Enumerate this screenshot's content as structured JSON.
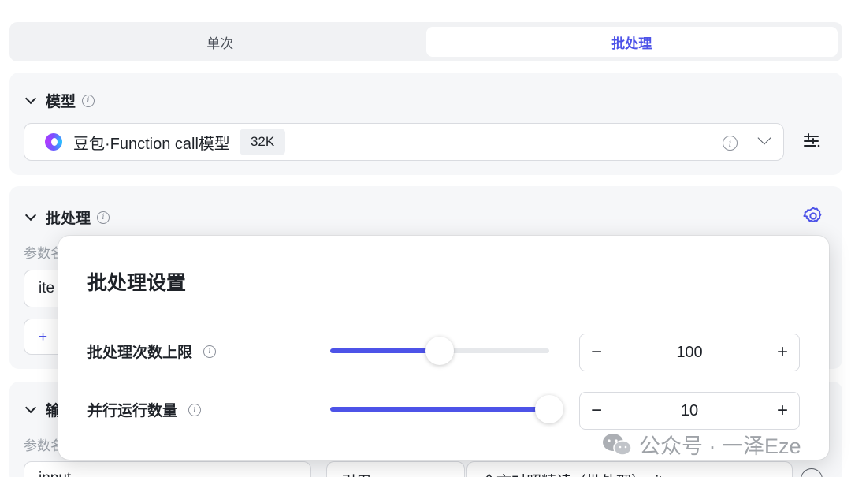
{
  "tabs": [
    {
      "label": "单次",
      "active": false
    },
    {
      "label": "批处理",
      "active": true
    }
  ],
  "model_section": {
    "title": "模型",
    "model_name": "豆包·Function call模型",
    "context_badge": "32K"
  },
  "batch_section": {
    "title": "批处理",
    "param_label_partial": "参数名",
    "field_partial": "ite",
    "add_partial": "+"
  },
  "output_section": {
    "title_partial": "输",
    "param_label_partial": "参数名",
    "field_partial": "input",
    "ref_partial": "引用",
    "source_partial": "全文对照精读（批处理）- it"
  },
  "popup": {
    "title": "批处理设置",
    "rows": [
      {
        "label": "批处理次数上限",
        "value": "100",
        "slider_fraction": 0.5
      },
      {
        "label": "并行运行数量",
        "value": "10",
        "slider_fraction": 1.0
      }
    ],
    "minus": "−",
    "plus": "+"
  },
  "watermark": {
    "text": "公众号 · 一泽Eze"
  },
  "colors": {
    "accent": "#4d53e8",
    "card_bg": "#f6f7f9",
    "border": "#d9dbe0"
  }
}
